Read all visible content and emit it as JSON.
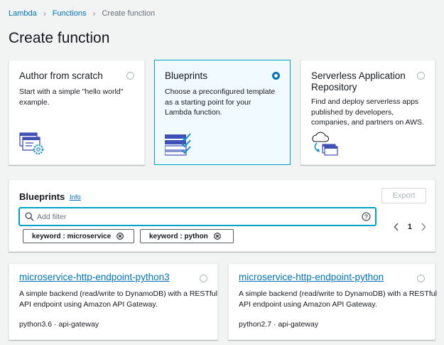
{
  "breadcrumb": {
    "items": [
      "Lambda",
      "Functions"
    ],
    "current": "Create function"
  },
  "page_title": "Create function",
  "options": [
    {
      "title": "Author from scratch",
      "description": "Start with a simple \"hello world\" example.",
      "selected": false,
      "icon": "code-gear-icon"
    },
    {
      "title": "Blueprints",
      "description": "Choose a preconfigured template as a starting point for your Lambda function.",
      "selected": true,
      "icon": "blueprint-checklist-icon"
    },
    {
      "title": "Serverless Application Repository",
      "description": "Find and deploy serverless apps published by developers, companies, and partners on AWS.",
      "selected": false,
      "icon": "cloud-deploy-icon"
    }
  ],
  "blueprints_panel": {
    "title": "Blueprints",
    "info_label": "Info",
    "export_label": "Export",
    "search_placeholder": "Add filter",
    "search_value": "",
    "filter_tokens": [
      "keyword : microservice",
      "keyword : python"
    ],
    "page": "1"
  },
  "blueprint_cards": [
    {
      "name": "microservice-http-endpoint-python3",
      "description": "A simple backend (read/write to DynamoDB) with a RESTful API endpoint using Amazon API Gateway.",
      "meta": "python3.6 · api-gateway"
    },
    {
      "name": "microservice-http-endpoint-python",
      "description": "A simple backend (read/write to DynamoDB) with a RESTful API endpoint using Amazon API Gateway.",
      "meta": "python2.7 · api-gateway"
    }
  ],
  "colors": {
    "link": "#0073bb",
    "selected_border": "#00a1c9",
    "selected_bg": "#f1faff",
    "background": "#f2f3f3"
  }
}
